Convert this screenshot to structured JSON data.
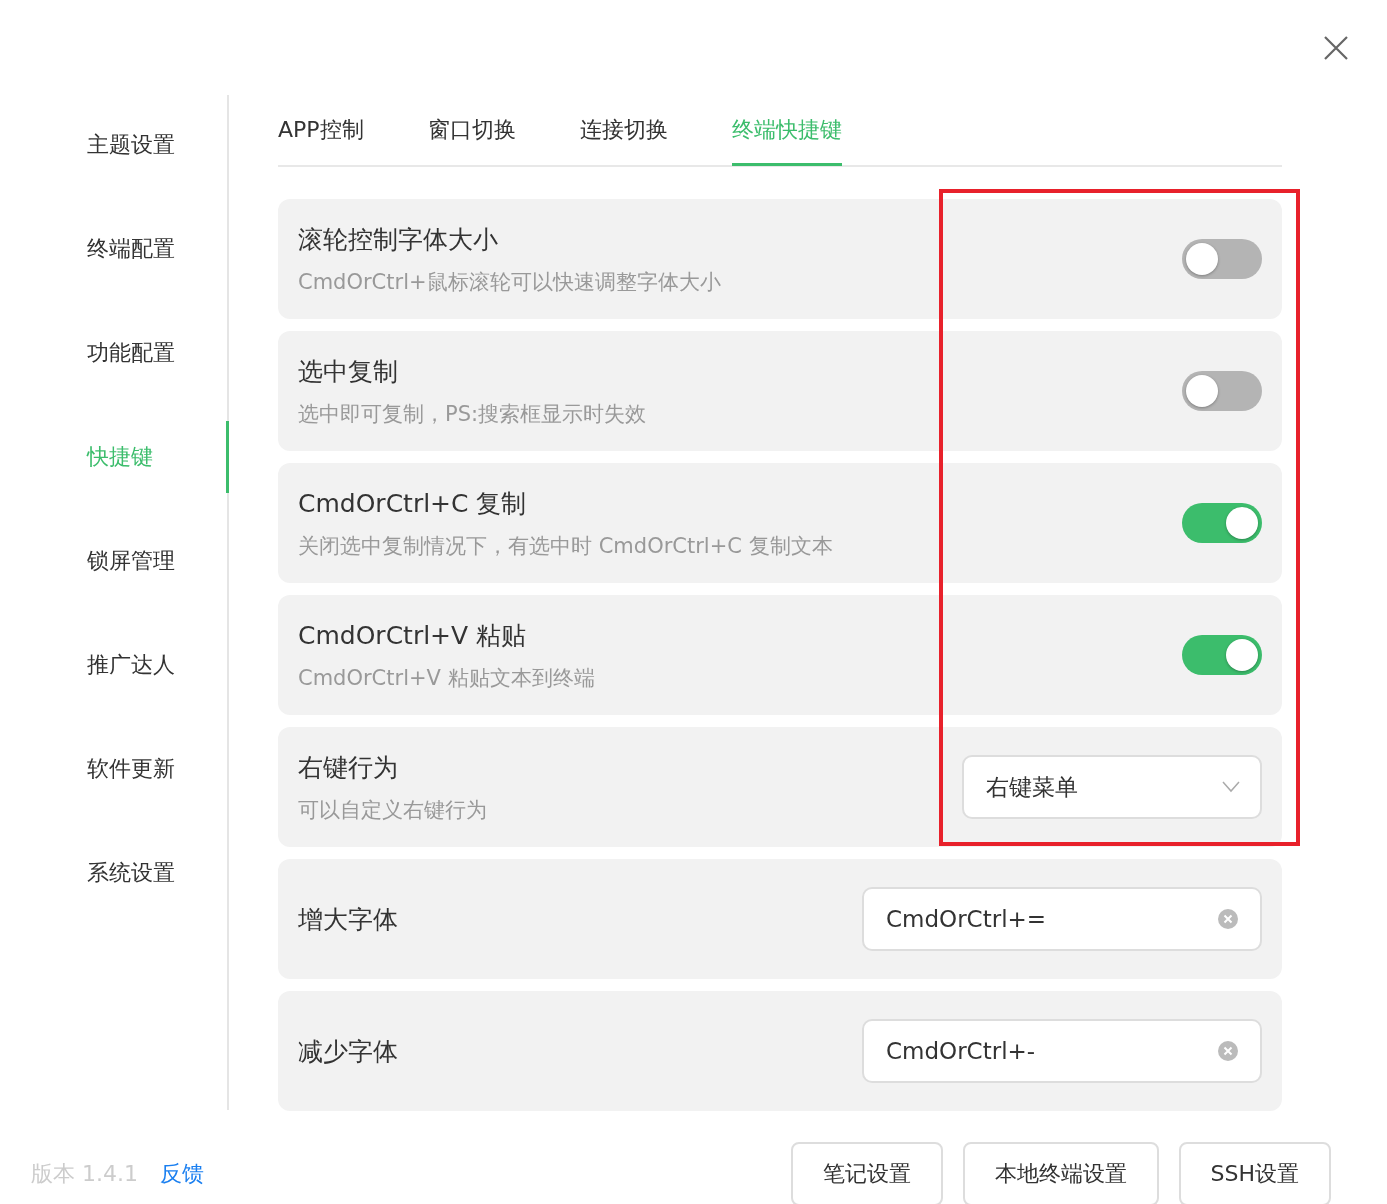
{
  "sidebar": {
    "items": [
      {
        "label": "主题设置",
        "selected": false
      },
      {
        "label": "终端配置",
        "selected": false
      },
      {
        "label": "功能配置",
        "selected": false
      },
      {
        "label": "快捷键",
        "selected": true
      },
      {
        "label": "锁屏管理",
        "selected": false
      },
      {
        "label": "推广达人",
        "selected": false
      },
      {
        "label": "软件更新",
        "selected": false
      },
      {
        "label": "系统设置",
        "selected": false
      }
    ]
  },
  "tabs": [
    {
      "label": "APP控制",
      "selected": false
    },
    {
      "label": "窗口切换",
      "selected": false
    },
    {
      "label": "连接切换",
      "selected": false
    },
    {
      "label": "终端快捷键",
      "selected": true
    }
  ],
  "settings": [
    {
      "kind": "toggle",
      "title": "滚轮控制字体大小",
      "description": "CmdOrCtrl+鼠标滚轮可以快速调整字体大小",
      "on": false
    },
    {
      "kind": "toggle",
      "title": "选中复制",
      "description": "选中即可复制，PS:搜索框显示时失效",
      "on": false
    },
    {
      "kind": "toggle",
      "title": "CmdOrCtrl+C 复制",
      "description": "关闭选中复制情况下，有选中时 CmdOrCtrl+C 复制文本",
      "on": true
    },
    {
      "kind": "toggle",
      "title": "CmdOrCtrl+V 粘贴",
      "description": "CmdOrCtrl+V 粘贴文本到终端",
      "on": true
    },
    {
      "kind": "select",
      "title": "右键行为",
      "description": "可以自定义右键行为",
      "value": "右键菜单"
    },
    {
      "kind": "shortcut",
      "title": "增大字体",
      "value": "CmdOrCtrl+="
    },
    {
      "kind": "shortcut",
      "title": "减少字体",
      "value": "CmdOrCtrl+-"
    }
  ],
  "footer": {
    "version": "版本 1.4.1",
    "feedback_link": "反馈",
    "buttons": [
      "笔记设置",
      "本地终端设置",
      "SSH设置"
    ]
  }
}
